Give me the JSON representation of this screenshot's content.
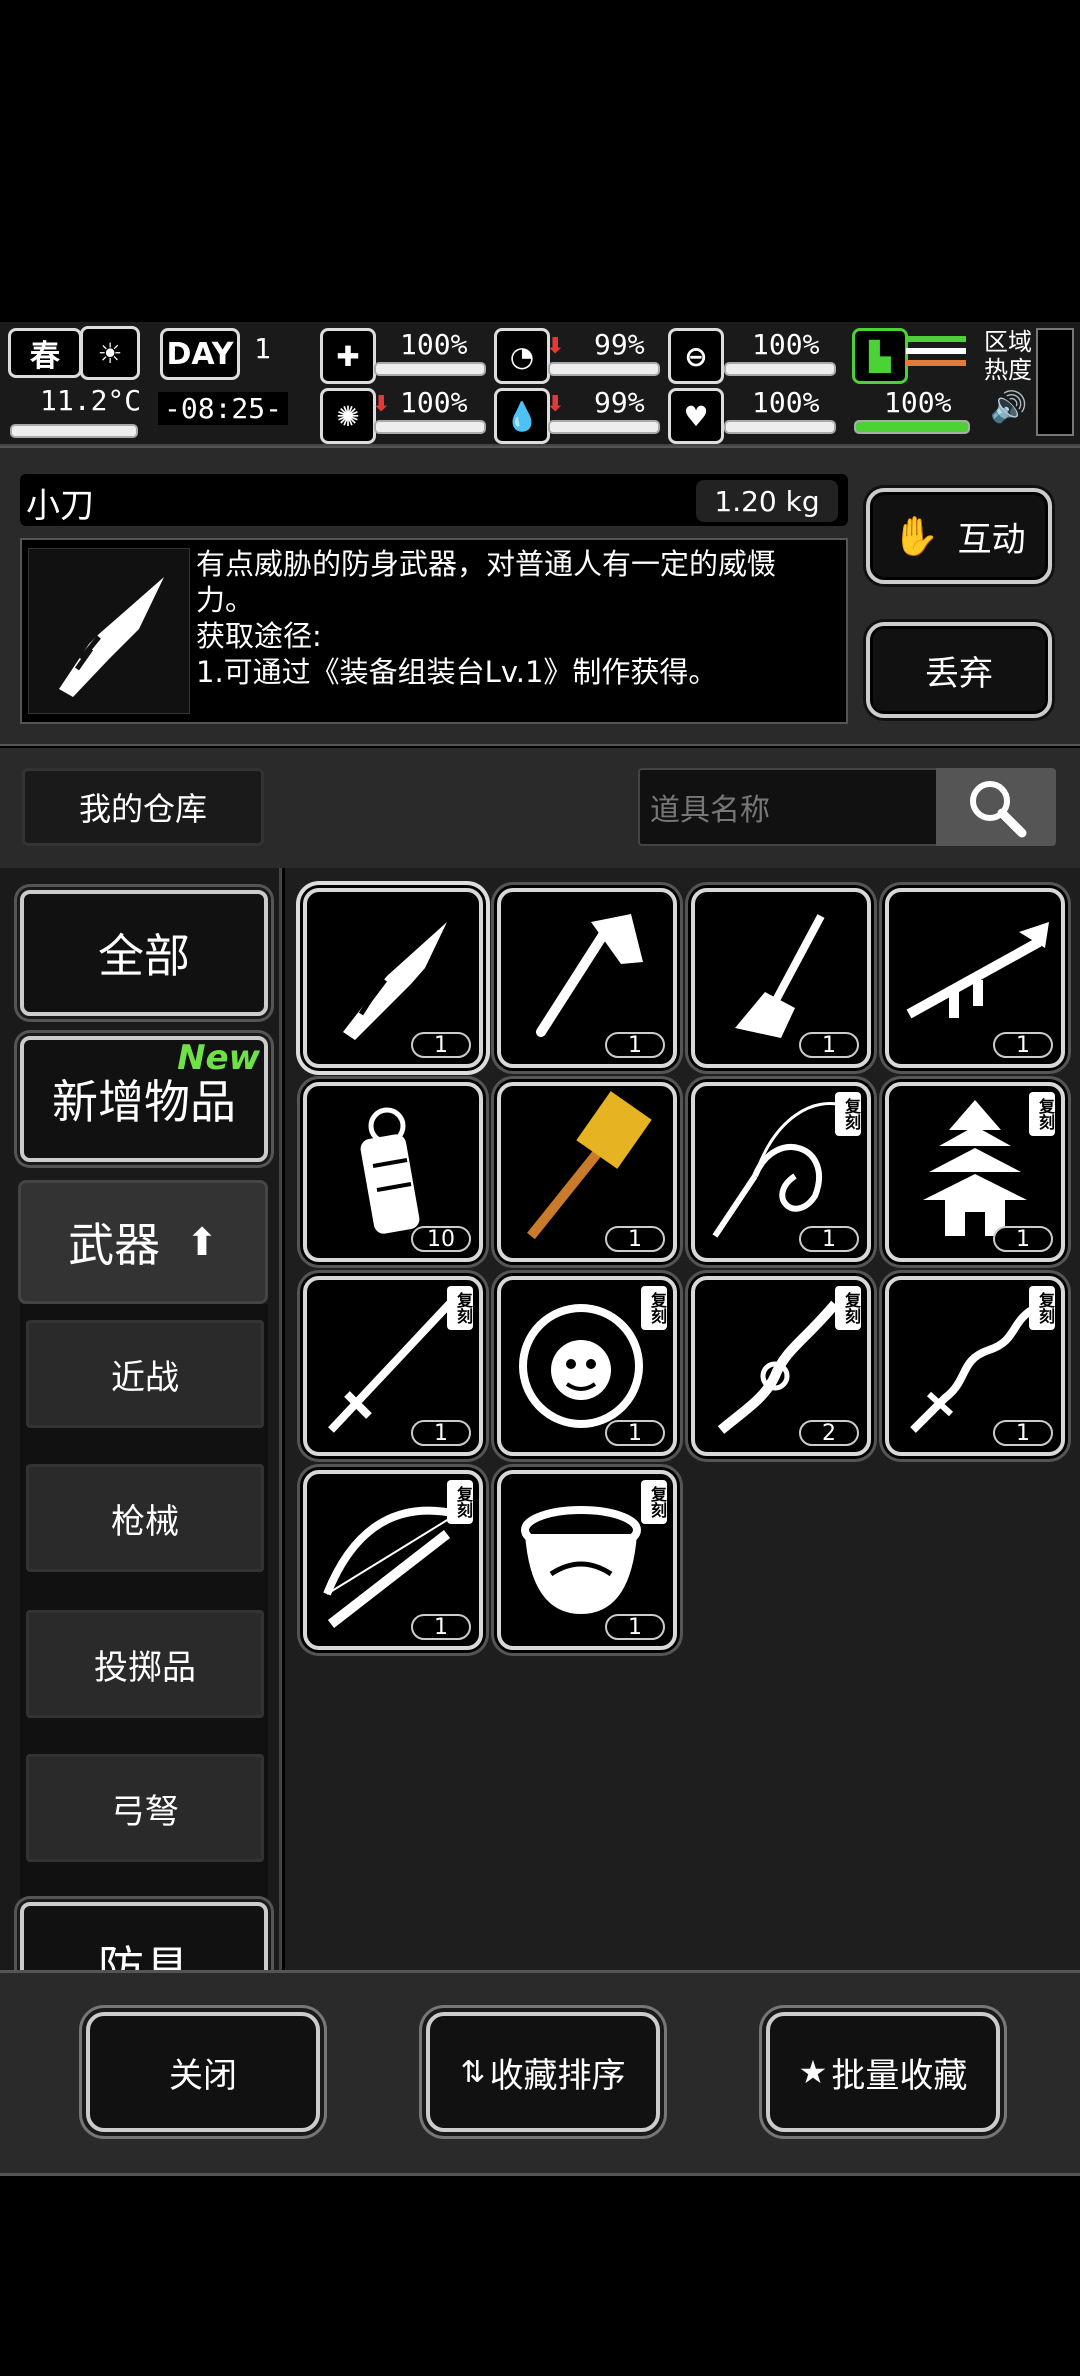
{
  "status": {
    "season": "春",
    "temperature": "11.2°C",
    "day_label": "DAY",
    "day_number": "1",
    "time": "-08:25-",
    "health_pct": "100%",
    "hunger_pct": "99%",
    "stamina_pct": "100%",
    "infection_pct": "100%",
    "thirst_pct": "99%",
    "mood_pct": "100%",
    "energy_pct": "100%",
    "region_heat": "区域\n热度"
  },
  "detail": {
    "name": "小刀",
    "weight": "1.20 kg",
    "description_line1": "有点威胁的防身武器，对普通人有一定的威慑",
    "description_line2": "力。",
    "source_label": "获取途径:",
    "source_line": "1.可通过《装备组装台Lv.1》制作获得。",
    "interact_label": "互动",
    "discard_label": "丢弃"
  },
  "warehouse": {
    "title": "我的仓库",
    "search_placeholder": "道具名称"
  },
  "sidebar": {
    "all": "全部",
    "new_items": "新增物品",
    "new_badge": "New",
    "weapons": "武器",
    "melee": "近战",
    "firearms": "枪械",
    "throwables": "投掷品",
    "bows": "弓弩",
    "armor": "防具"
  },
  "items": [
    {
      "name": "knife",
      "count": "1",
      "replica": false
    },
    {
      "name": "axe",
      "count": "1",
      "replica": false
    },
    {
      "name": "shovel",
      "count": "1",
      "replica": false
    },
    {
      "name": "rocket-launcher",
      "count": "1",
      "replica": false
    },
    {
      "name": "grenade",
      "count": "10",
      "replica": false
    },
    {
      "name": "golden-hammer",
      "count": "1",
      "replica": false
    },
    {
      "name": "whip",
      "count": "1",
      "replica": true
    },
    {
      "name": "pagoda",
      "count": "1",
      "replica": true
    },
    {
      "name": "sword",
      "count": "1",
      "replica": true
    },
    {
      "name": "medusa-shield",
      "count": "1",
      "replica": true
    },
    {
      "name": "dragon-blade",
      "count": "2",
      "replica": true
    },
    {
      "name": "serpent-sword",
      "count": "1",
      "replica": true
    },
    {
      "name": "crossbow",
      "count": "1",
      "replica": true
    },
    {
      "name": "bowl",
      "count": "1",
      "replica": true
    }
  ],
  "replica_label": "复刻",
  "footer": {
    "close": "关闭",
    "sort_favorites": "收藏排序",
    "batch_favorite": "批量收藏"
  },
  "colors": {
    "accent_green": "#4cd137",
    "new_badge": "#6fe04a",
    "down_arrow": "#e53935",
    "hammer_gold": "#e6b422"
  }
}
